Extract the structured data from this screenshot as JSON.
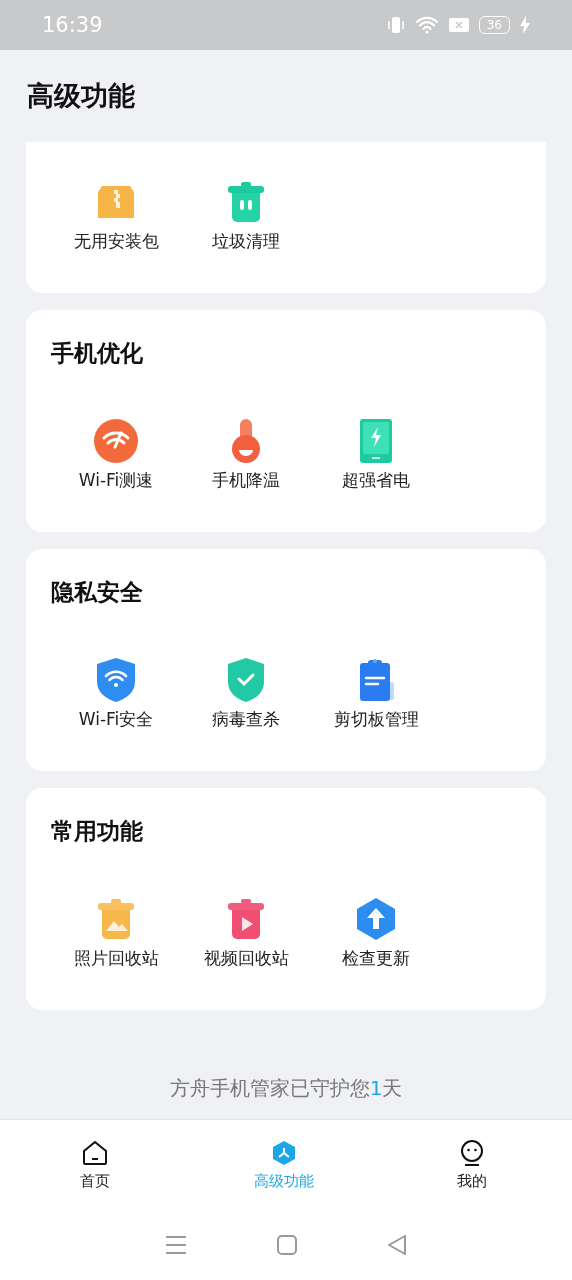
{
  "status_bar": {
    "time": "16:39",
    "battery": "36"
  },
  "title": "高级功能",
  "sections": [
    {
      "items": [
        {
          "label": "无用安装包"
        },
        {
          "label": "垃圾清理"
        }
      ]
    },
    {
      "title": "手机优化",
      "items": [
        {
          "label": "Wi-Fi测速"
        },
        {
          "label": "手机降温"
        },
        {
          "label": "超强省电"
        }
      ]
    },
    {
      "title": "隐私安全",
      "items": [
        {
          "label": "Wi-Fi安全"
        },
        {
          "label": "病毒查杀"
        },
        {
          "label": "剪切板管理"
        }
      ]
    },
    {
      "title": "常用功能",
      "items": [
        {
          "label": "照片回收站"
        },
        {
          "label": "视频回收站"
        },
        {
          "label": "检查更新"
        }
      ]
    }
  ],
  "footer": {
    "prefix": "方舟手机管家已守护您",
    "count": "1",
    "suffix": "天"
  },
  "tabs": [
    {
      "label": "首页",
      "selected": false
    },
    {
      "label": "高级功能",
      "selected": true
    },
    {
      "label": "我的",
      "selected": false
    }
  ]
}
